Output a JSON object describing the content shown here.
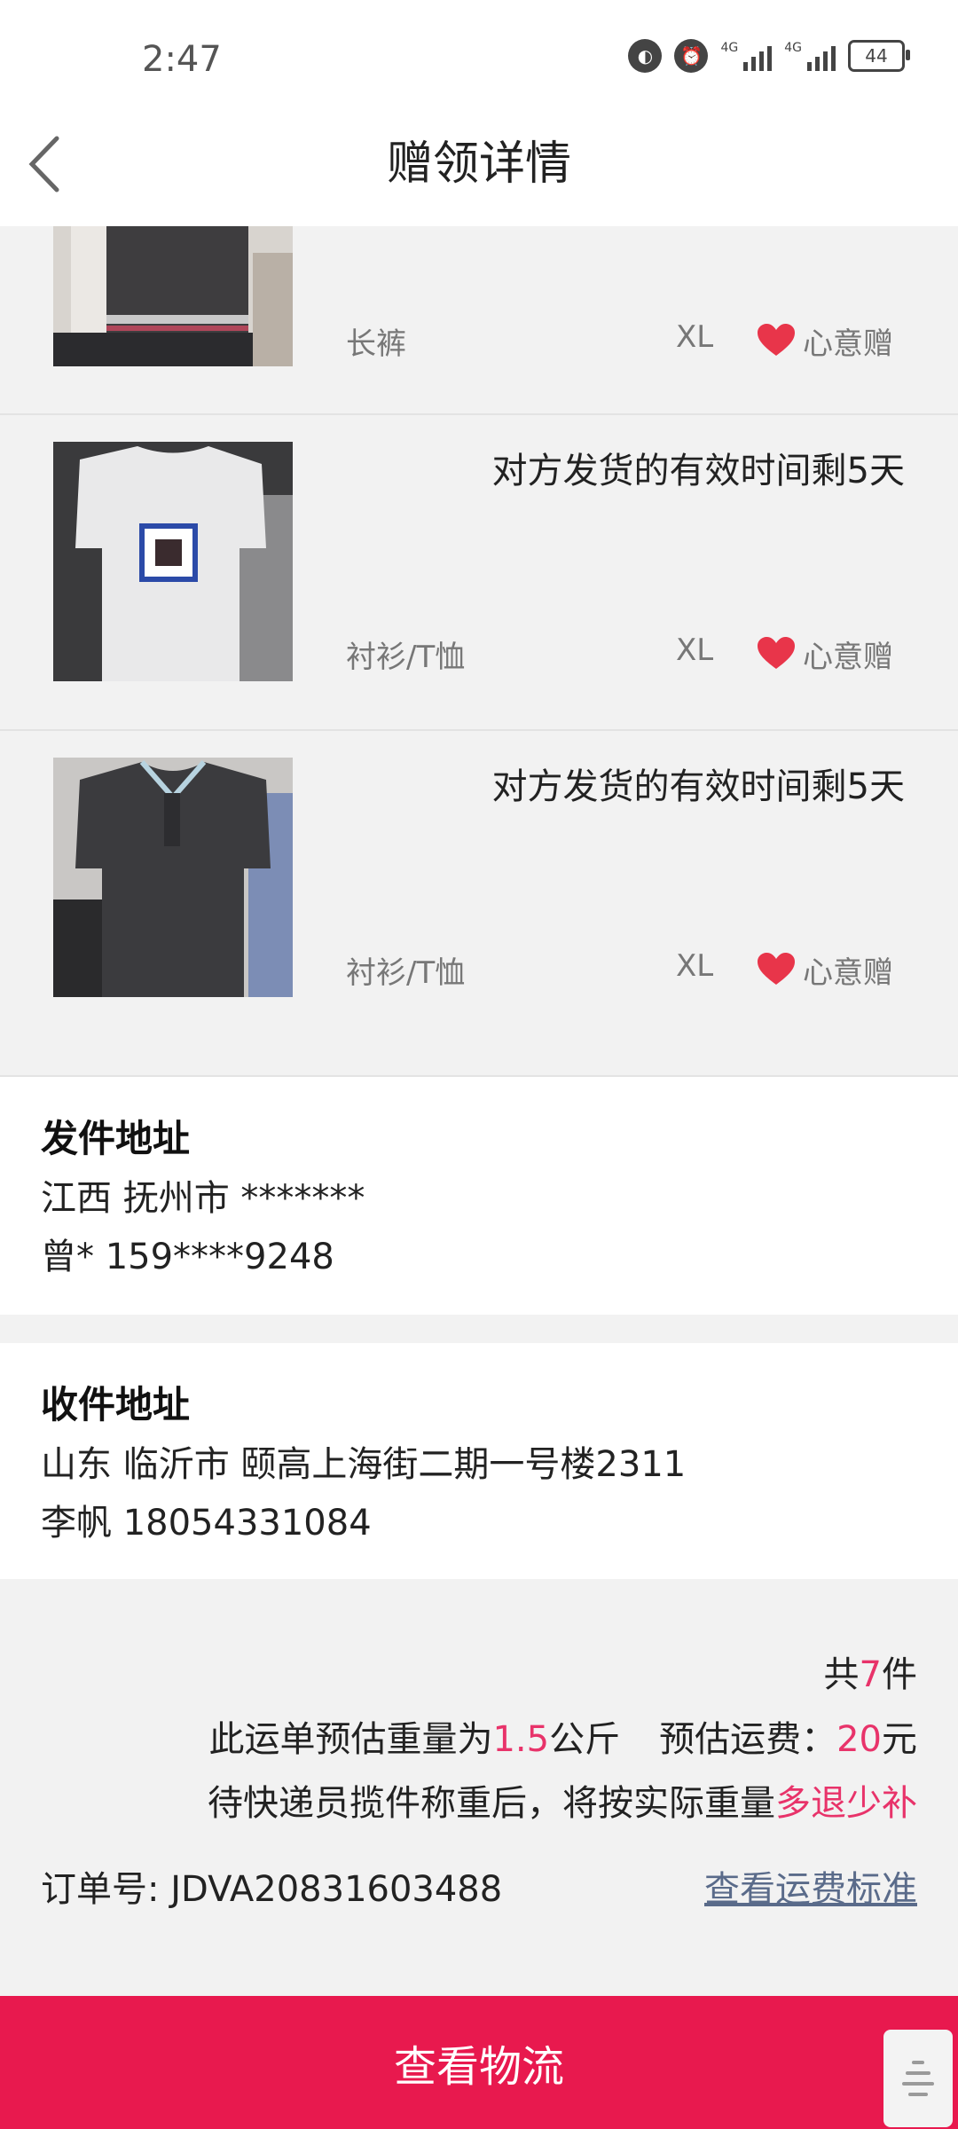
{
  "status_bar": {
    "time": "2:47",
    "network_label": "4G",
    "battery": "44"
  },
  "header": {
    "title": "赠领详情"
  },
  "items": [
    {
      "category": "长裤",
      "size": "XL",
      "gift_type": "心意赠",
      "deadline": ""
    },
    {
      "category": "衬衫/T恤",
      "size": "XL",
      "gift_type": "心意赠",
      "deadline": "对方发货的有效时间剩5天"
    },
    {
      "category": "衬衫/T恤",
      "size": "XL",
      "gift_type": "心意赠",
      "deadline": "对方发货的有效时间剩5天"
    }
  ],
  "sender": {
    "title": "发件地址",
    "address": "江西 抚州市 *******",
    "contact": "曾* 159****9248"
  },
  "receiver": {
    "title": "收件地址",
    "address": "山东 临沂市 颐高上海街二期一号楼2311",
    "contact": "李帆 18054331084"
  },
  "summary": {
    "count_prefix": "共",
    "count": "7",
    "count_suffix": "件",
    "weight_prefix": "此运单预估重量为",
    "weight": "1.5",
    "weight_unit": "公斤",
    "fee_label": "预估运费：",
    "fee": "20",
    "fee_unit": "元",
    "note": "待快递员揽件称重后，将按实际重量",
    "note_highlight": "多退少补",
    "order_label": "订单号:",
    "order_number": "JDVA20831603488",
    "fee_standard_link": "查看运费标准"
  },
  "bottom_button": "查看物流",
  "colors": {
    "accent": "#e8194e",
    "highlight_red": "#e8336a",
    "heart": "#e8354a",
    "link": "#5a6b8a"
  }
}
